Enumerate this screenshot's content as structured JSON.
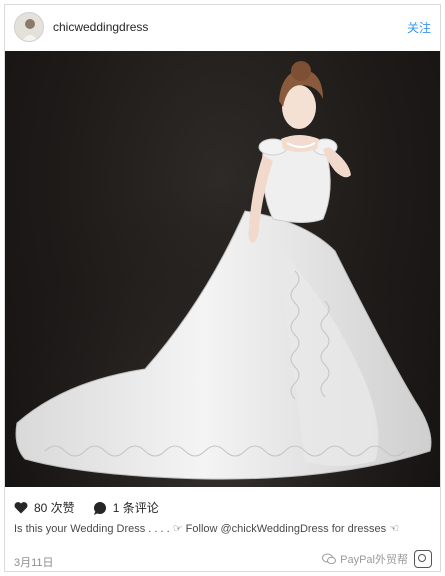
{
  "header": {
    "username": "chicweddingdress",
    "follow_label": "关注"
  },
  "post": {
    "likes_label": "80 次赞",
    "comments_label": "1 条评论",
    "caption": "Is this your Wedding Dress . . . . ☞ Follow @chickWeddingDress for dresses ☜",
    "date": "3月11日"
  },
  "watermark": {
    "text": "PayPal外贸帮"
  },
  "colors": {
    "link": "#3897f0",
    "text": "#262626",
    "muted": "#8e8e8e",
    "photo_background": "#1d1a18"
  },
  "icons": [
    "heart-icon",
    "comment-bubble-icon",
    "instagram-icon",
    "wechat-icon"
  ]
}
